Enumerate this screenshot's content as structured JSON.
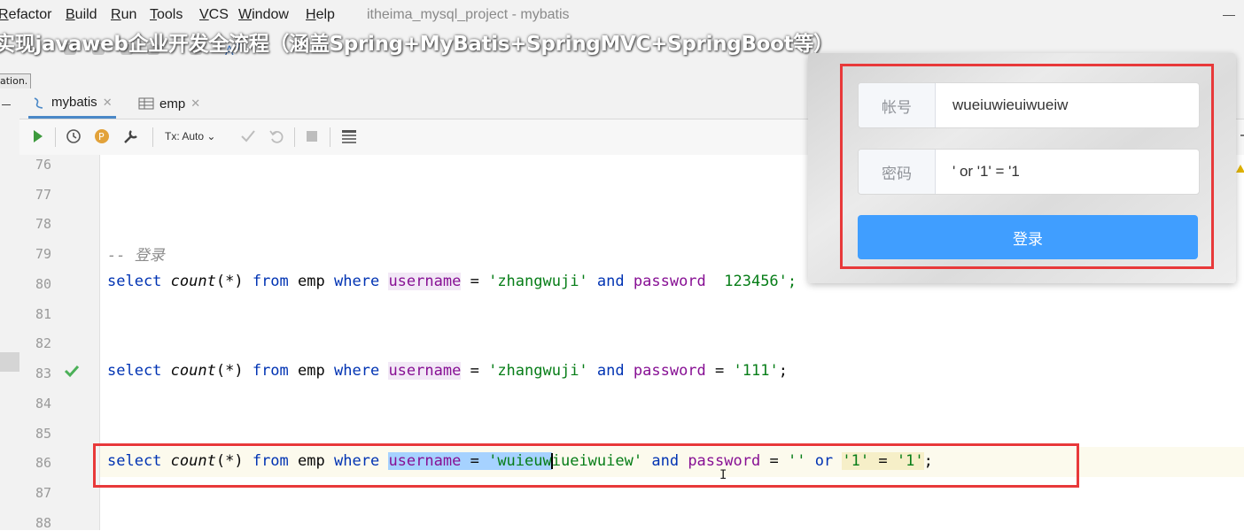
{
  "menu": {
    "items": [
      {
        "label": "Refactor"
      },
      {
        "label": "Build"
      },
      {
        "label": "Run"
      },
      {
        "label": "Tools"
      },
      {
        "label": "VCS"
      },
      {
        "label": "Window"
      },
      {
        "label": "Help"
      }
    ],
    "window_title": "itheima_mysql_project - mybatis"
  },
  "overlay_caption": "实现javaweb企业开发全流程（涵盖Spring+MyBatis+SpringMVC+SpringBoot等）",
  "toolbar": {
    "partial_label": "ation."
  },
  "tabs": [
    {
      "label": "mybatis",
      "icon": "sql-console-icon",
      "active": true
    },
    {
      "label": "emp",
      "icon": "table-icon",
      "active": false
    }
  ],
  "editor_toolbar": {
    "tx_mode": "Tx: Auto",
    "icons": [
      "run-icon",
      "history-icon",
      "pin-icon",
      "wrench-icon",
      "commit-icon",
      "rollback-icon",
      "stop-icon",
      "table-layout-icon"
    ]
  },
  "editor": {
    "line_numbers": [
      "76",
      "77",
      "78",
      "79",
      "80",
      "81",
      "82",
      "83",
      "84",
      "85",
      "86",
      "87",
      "88"
    ],
    "comment": "-- 登录",
    "kw_select": "select",
    "fn_count": "count",
    "count_args": "(*)",
    "kw_from": "from",
    "table": "emp",
    "kw_where": "where",
    "col_username": "username",
    "eq": "=",
    "kw_and": "and",
    "col_password": "password",
    "line80_user": "'zhangwuji'",
    "line80_pass_tail": "  123456';",
    "line83_user": "'zhangwuji'",
    "line83_pass": "'111'",
    "line86_user_selected": "'wuieuw",
    "line86_user_rest": "iueiwuiew'",
    "line86_empty_str": "''",
    "kw_or": "or",
    "str_one": "'1'",
    "semicolon": ";",
    "colors": {
      "keyword": "#0033b3",
      "string": "#067d17",
      "column": "#871094",
      "selection": "#a6d2ff"
    }
  },
  "login_form": {
    "account_label": "帐号",
    "account_value": "wueiuwieuiwueiw",
    "password_label": "密码",
    "password_value": "' or '1' = '1",
    "submit_label": "登录",
    "button_color": "#409eff"
  },
  "annotations": {
    "highlight_color": "#e8393a"
  }
}
